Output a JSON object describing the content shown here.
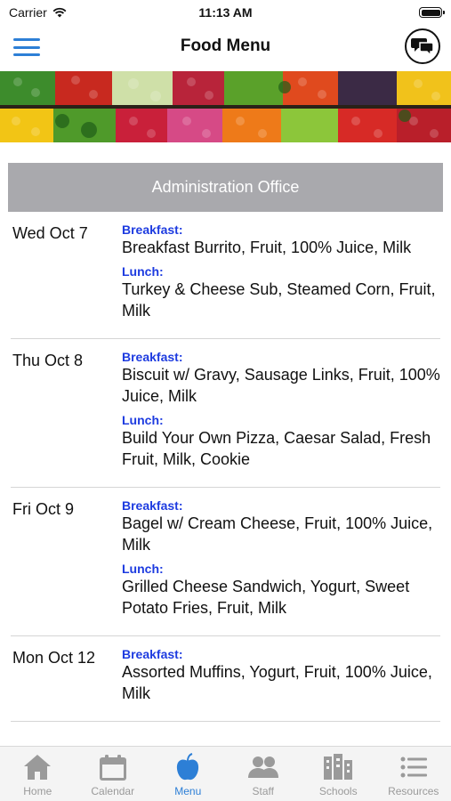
{
  "status_bar": {
    "carrier": "Carrier",
    "time": "11:13 AM"
  },
  "nav": {
    "title": "Food Menu",
    "menu_icon": "hamburger-menu-icon",
    "chat_icon": "chat-bubbles-icon"
  },
  "banner": {
    "icon": "vegetable-crates-image"
  },
  "school": {
    "name": "Administration Office"
  },
  "days": [
    {
      "date": "Wed Oct 7",
      "breakfast_label": "Breakfast:",
      "breakfast": "Breakfast Burrito, Fruit, 100% Juice, Milk",
      "lunch_label": "Lunch:",
      "lunch": "Turkey & Cheese Sub, Steamed Corn, Fruit, Milk"
    },
    {
      "date": "Thu Oct 8",
      "breakfast_label": "Breakfast:",
      "breakfast": "Biscuit w/ Gravy, Sausage Links, Fruit, 100% Juice, Milk",
      "lunch_label": "Lunch:",
      "lunch": "Build Your Own Pizza, Caesar Salad, Fresh Fruit, Milk, Cookie"
    },
    {
      "date": "Fri Oct 9",
      "breakfast_label": "Breakfast:",
      "breakfast": "Bagel w/ Cream Cheese, Fruit, 100% Juice, Milk",
      "lunch_label": "Lunch:",
      "lunch": "Grilled Cheese Sandwich, Yogurt, Sweet Potato Fries, Fruit, Milk"
    },
    {
      "date": "Mon Oct 12",
      "breakfast_label": "Breakfast:",
      "breakfast": "Assorted Muffins, Yogurt, Fruit, 100% Juice, Milk",
      "lunch_label": "",
      "lunch": ""
    }
  ],
  "tabs": [
    {
      "label": "Home",
      "icon": "house-icon"
    },
    {
      "label": "Calendar",
      "icon": "calendar-icon"
    },
    {
      "label": "Menu",
      "icon": "apple-icon"
    },
    {
      "label": "Staff",
      "icon": "people-icon"
    },
    {
      "label": "Schools",
      "icon": "buildings-icon"
    },
    {
      "label": "Resources",
      "icon": "list-icon"
    }
  ],
  "colors": {
    "accent": "#2d7fd6",
    "meal_label": "#1d3be0",
    "header_bg": "#a9a9ad",
    "inactive_tab": "#9a9a9a"
  }
}
